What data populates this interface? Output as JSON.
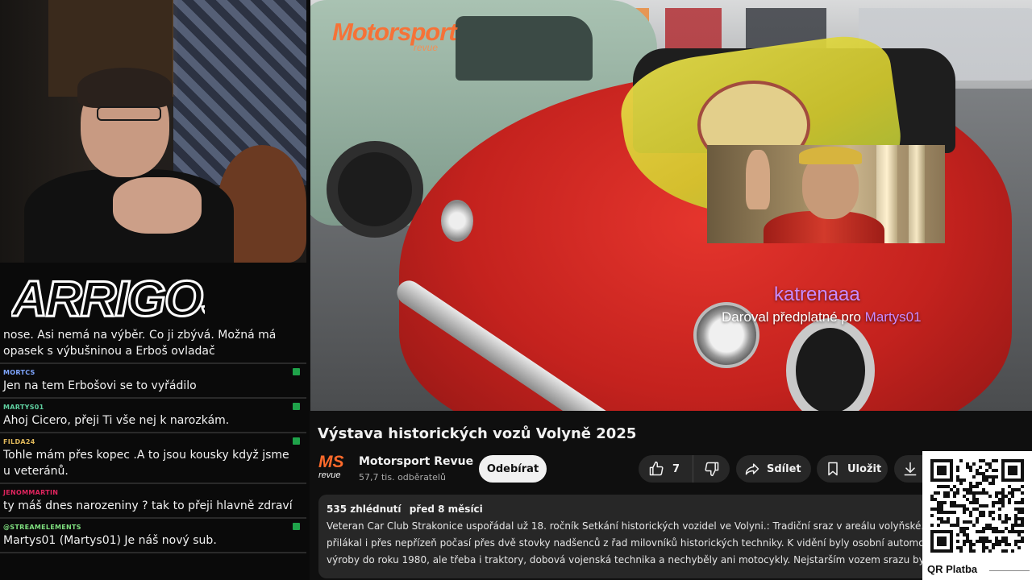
{
  "stream": {
    "logo_text": "ARRIGOS"
  },
  "chat": {
    "messages": [
      {
        "user": "",
        "text": "nose. Asi nemá na výběr. Co ji zbývá. Možná má opasek s výbušninou a Erboš ovladač",
        "user_color": "#ffffff",
        "badge": false
      },
      {
        "user": "MORTCS",
        "text": "Jen na tem Erbošovi se to vyřádilo",
        "user_color": "#7fa6ff",
        "badge": true
      },
      {
        "user": "MARTYS01",
        "text": "Ahoj Cicero, přeji Ti vše nej k narozkám.",
        "user_color": "#5fd0a0",
        "badge": true
      },
      {
        "user": "FILDA24",
        "text": "Tohle mám přes kopec .A to jsou kousky když jsme u veteránů.",
        "user_color": "#e0b85a",
        "badge": true
      },
      {
        "user": "JENOMMARTIN",
        "text": "ty máš dnes narozeniny ? tak to přeji hlavně zdraví",
        "user_color": "#e0245e",
        "badge": false
      },
      {
        "user": "@STREAMELEMENTS",
        "text": "Martys01 (Martys01) Je náš nový sub.",
        "user_color": "#7fe07f",
        "badge": true
      }
    ]
  },
  "video": {
    "watermark": "Motorsport",
    "watermark_sub": "revue",
    "alert": {
      "name": "katrenaaa",
      "message_prefix": "Daroval předplatné pro ",
      "message_target": "Martys01"
    }
  },
  "youtube": {
    "title": "Výstava historických vozů Volyně 2025",
    "channel": {
      "logo_main": "MS",
      "logo_sub": "revue",
      "name": "Motorsport Revue",
      "subscribers": "57,7 tis. odběratelů"
    },
    "subscribe_label": "Odebírat",
    "like_count": "7",
    "share_label": "Sdílet",
    "save_label": "Uložit",
    "description": {
      "views": "535 zhlédnutí",
      "date": "před 8 měsíci",
      "text": "Veteran Car Club Strakonice uspořádal už 18. ročník Setkání historických vozidel ve Volyni.: Tradiční sraz v areálu volyňské... přilákal i přes nepřízeň počasí přes dvě stovky nadšenců z řad milovníků historických techniky. K vidění byly osobní automo... výroby do roku 1980, ale třeba i traktory, dobová vojenská technika a nechyběly ani motocykly. Nejstarším vozem srazu byl..."
    },
    "icons": {
      "like": "thumbs-up-icon",
      "dislike": "thumbs-down-icon",
      "share": "share-arrow-icon",
      "save": "bookmark-icon",
      "download": "download-icon"
    }
  },
  "qr": {
    "label": "QR Platba"
  },
  "colors": {
    "alert_name": "#c98bff",
    "subscribe_bg": "#f1f1f1",
    "pill_bg": "#272727",
    "watermark": "#ff6a2b"
  }
}
